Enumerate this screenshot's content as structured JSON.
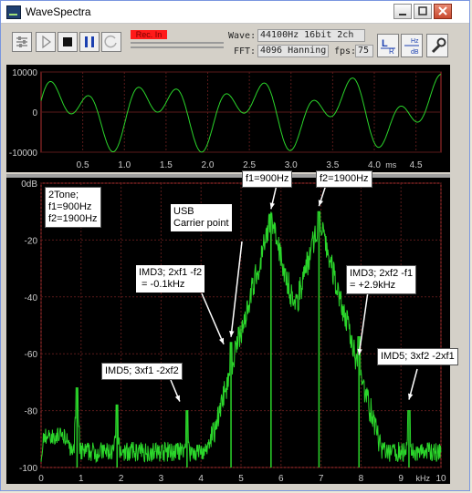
{
  "window": {
    "title": "WaveSpectra"
  },
  "toolbar": {
    "rec_label": "Rec. In",
    "wave_label": "Wave:",
    "wave_value": "44100Hz 16bit 2ch",
    "fft_label": "FFT:",
    "fft_value": "4096 Hanning",
    "fps_label": "fps:",
    "fps_value": "75",
    "lr_label": "L R",
    "dbhz_label": "Hz dB"
  },
  "waveform": {
    "y_ticks": [
      "10000",
      "0",
      "-10000"
    ],
    "x_ticks": [
      "0.5",
      "1.0",
      "1.5",
      "2.0",
      "2.5",
      "3.0",
      "3.5",
      "4.0",
      "4.5"
    ],
    "x_unit": "ms",
    "color": "#2bd62b"
  },
  "spectrum": {
    "y_ticks": [
      "0dB",
      "-20",
      "-40",
      "-60",
      "-80",
      "-100"
    ],
    "x_ticks": [
      "0",
      "1",
      "2",
      "3",
      "4",
      "5",
      "6",
      "7",
      "8",
      "9",
      "10"
    ],
    "x_unit": "kHz",
    "color": "#2bd62b",
    "axis_color": "#b03030"
  },
  "chart_data": {
    "type": "line",
    "xlabel": "kHz",
    "ylabel": "dB",
    "xlim": [
      0,
      10
    ],
    "ylim": [
      -100,
      0
    ],
    "peaks": [
      {
        "x": 0.9,
        "y": -72
      },
      {
        "x": 1.9,
        "y": -78
      },
      {
        "x": 3.65,
        "y": -80
      },
      {
        "x": 4.75,
        "y": -56
      },
      {
        "x": 5.75,
        "y": -11
      },
      {
        "x": 6.95,
        "y": -10
      },
      {
        "x": 7.95,
        "y": -54
      },
      {
        "x": 9.2,
        "y": -80
      }
    ]
  },
  "annotations": {
    "two_tone": "2Tone;\nf1=900Hz\nf2=1900Hz",
    "usb": "USB\nCarrier point",
    "f1": "f1=900Hz",
    "f2": "f2=1900Hz",
    "imd3_low": "IMD3; 2xf1 -f2\n = -0.1kHz",
    "imd3_high": "IMD3; 2xf2 -f1\n= +2.9kHz",
    "imd5_low": "IMD5; 3xf1 -2xf2",
    "imd5_high": "IMD5; 3xf2 -2xf1"
  }
}
